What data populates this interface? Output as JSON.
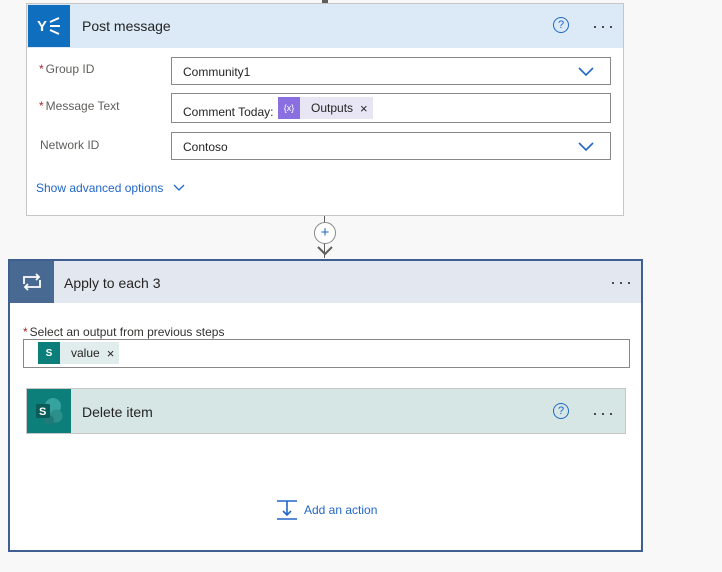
{
  "post_message": {
    "title": "Post message",
    "help_icon": "?",
    "more_label": "···",
    "fields": {
      "group_id": {
        "label": "Group ID",
        "required": "*",
        "value": "Community1"
      },
      "message_text": {
        "label": "Message Text",
        "required": "*",
        "prefix_text": "Comment Today:",
        "token_label": "Outputs",
        "token_icon": "{x}"
      },
      "network_id": {
        "label": "Network ID",
        "value": "Contoso"
      }
    },
    "advanced_options": "Show advanced options"
  },
  "connector": {
    "plus_label": "+"
  },
  "apply_to_each": {
    "title": "Apply to each 3",
    "more_label": "···",
    "select_output_label": "Select an output from previous steps",
    "required": "*",
    "token_label": "value",
    "token_icon": "S",
    "token_remove": "×",
    "delete_item": {
      "title": "Delete item",
      "help_icon": "?",
      "more_label": "···"
    },
    "add_action": "Add an action"
  },
  "colors": {
    "header_blue": "#dbeaf6",
    "yammer_blue": "#106ebe",
    "loop_header": "#486991",
    "sharepoint_teal": "#0d7f7a",
    "link_blue": "#2266c7"
  },
  "icons": {
    "yammer": "yammer-icon",
    "loop": "loop-icon",
    "sharepoint": "sharepoint-icon",
    "dropdown": "chevron-down-icon",
    "add_action": "add-action-icon"
  },
  "remove_symbol": "×"
}
